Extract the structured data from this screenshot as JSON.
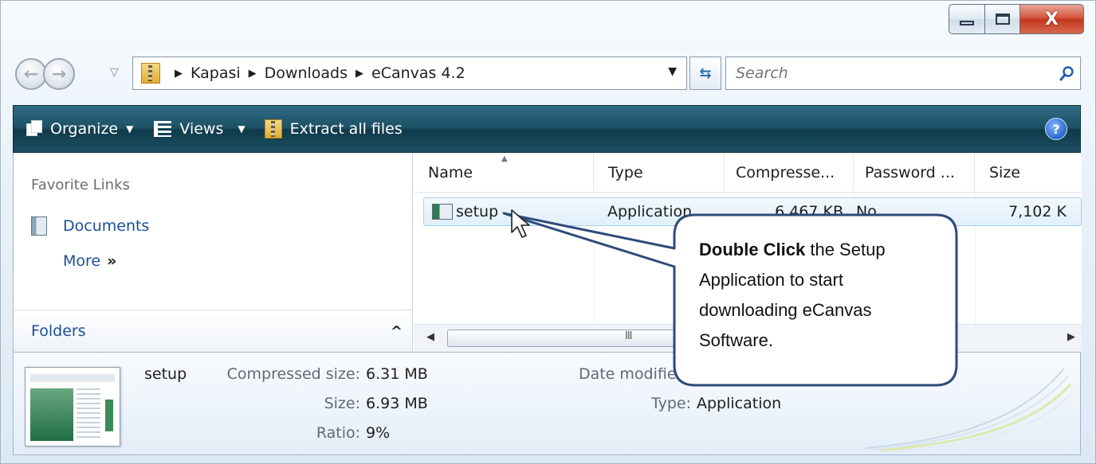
{
  "window": {
    "controls": {
      "minimize": "minimize",
      "maximize": "maximize",
      "close": "X"
    }
  },
  "nav": {
    "breadcrumb": [
      "Kapasi",
      "Downloads",
      "eCanvas 4.2"
    ],
    "search_placeholder": "Search"
  },
  "toolbar": {
    "organize_label": "Organize",
    "views_label": "Views",
    "extract_label": "Extract all files",
    "help_label": "?"
  },
  "navpane": {
    "favorites_title": "Favorite Links",
    "links": [
      {
        "label": "Documents",
        "icon": "documents-icon"
      }
    ],
    "more_label": "More",
    "folders_label": "Folders"
  },
  "filelist": {
    "columns": [
      "Name",
      "Type",
      "Compresse...",
      "Password ...",
      "Size"
    ],
    "rows": [
      {
        "name": "setup",
        "type": "Application",
        "compressed": "6,467 KB",
        "password": "No",
        "size": "7,102 K"
      }
    ]
  },
  "details": {
    "name": "setup",
    "compressed_label": "Compressed size:",
    "compressed_value": "6.31 MB",
    "size_label": "Size:",
    "size_value": "6.93 MB",
    "ratio_label": "Ratio:",
    "ratio_value": "9%",
    "date_label": "Date modified:",
    "type_label": "Type:",
    "type_value": "Application"
  },
  "callout": {
    "bold": "Double Click",
    "rest": " the Setup Application to start downloading eCanvas Software."
  },
  "colors": {
    "toolbar": "#1d5064",
    "link": "#1a4f97",
    "selection": "#e1effa",
    "callout_border": "#2e4a7a"
  }
}
